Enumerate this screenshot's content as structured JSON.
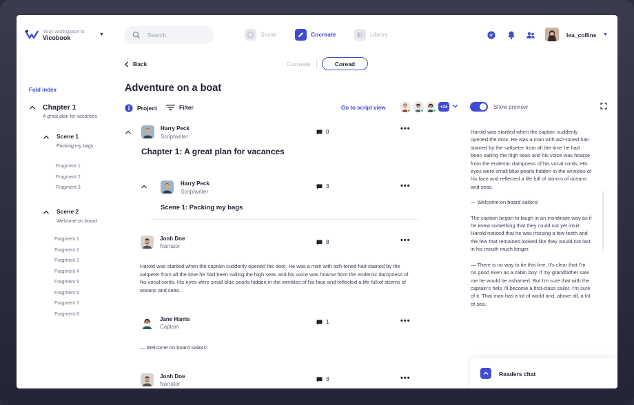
{
  "header": {
    "workspace_caption": "Your workspace is",
    "workspace_name": "Vicobook",
    "search_placeholder": "Search",
    "nav": [
      {
        "label": "Social",
        "icon": "social-icon",
        "active": false
      },
      {
        "label": "Cocreate",
        "icon": "pencil-icon",
        "active": true
      },
      {
        "label": "Library",
        "icon": "library-icon",
        "active": false
      }
    ],
    "username": "lea_collins"
  },
  "subbar": {
    "back_label": "Back",
    "modes": [
      "Cocreate",
      "Coread"
    ],
    "active_mode": "Coread"
  },
  "index": {
    "fold_label": "Fold index",
    "chapter": {
      "title": "Chapter 1",
      "subtitle": "A great plan for vacances"
    },
    "scenes": [
      {
        "title": "Scene 1",
        "subtitle": "Packing my bags",
        "fragments": [
          "Fragment 1",
          "Fragment 2",
          "Fragment 3"
        ]
      },
      {
        "title": "Scene 2",
        "subtitle": "Welcome on board",
        "fragments": [
          "Fragment 1",
          "Fragment 2",
          "Fragment 3",
          "Fragment 4",
          "Fragment 5",
          "Fragment 6",
          "Fragment 7",
          "Fragment 8"
        ]
      }
    ]
  },
  "main": {
    "title": "Adventure on a boat",
    "project_label": "Project",
    "filter_label": "Filter",
    "goto_label": "Go to script view",
    "more_collaborators": "+24",
    "blocks": [
      {
        "name": "Harry Peck",
        "role": "Scriptwriter",
        "count": "0"
      },
      {
        "name": "Harry Peck",
        "role": "Scriptwriter",
        "count": "3"
      },
      {
        "name": "Jonh Doe",
        "role": "Narrator",
        "count": "8"
      },
      {
        "name": "Jane Harris",
        "role": "Captain",
        "count": "1"
      },
      {
        "name": "Jonh Doe",
        "role": "Narrator",
        "count": "3"
      }
    ],
    "chapter_heading": "Chapter 1: A great plan for vacances",
    "scene_heading": "Scene 1: Packing my bags",
    "narration": "Harold was startled when the captain suddenly opened the door. He was a man with ash-toned hair stained by the saltpeter from all the time he had been sailing the high seas and his voice was hoarse from the endemic dampness of his vocal cords. His eyes were small blue pearls hidden in the wrinkles of his face and reflected a life full of storms of oceans and seas.",
    "captain_line": "— Welcome on board sailors!"
  },
  "preview": {
    "toggle_label": "Show preview",
    "paragraphs": [
      "Harold was startled when the captain suddenly opened the door. He was a man with ash-toned hair stained by the saltpeter from all the time he had been sailing the high seas and his voice was hoarse from the endemic dampness of his vocal cords. His eyes were small blue pearls hidden in the wrinkles of his face and reflected a life full of storms of oceans and seas.",
      "— Welcome on board sailors!",
      "The captain began to laugh in an inordinate way as if he knew something that they could not yet intuit. Harold noticed that he was missing a few teeth and the few that remained looked like they would not last in his mouth much longer.",
      "— There is no way to tie this line. It's clear that I'm no good even as a cabin boy. If my grandfather saw me he would be ashamed. But I'm sure that with the captain's help I'll become a first-class sailor. I'm sure of it. That man has a lot of world and, above all, a lot of sea."
    ],
    "readers_chat_label": "Readers chat"
  },
  "colors": {
    "accent": "#3f4bd0",
    "frame": "#2b2d3e",
    "muted": "#b4b6c4"
  }
}
